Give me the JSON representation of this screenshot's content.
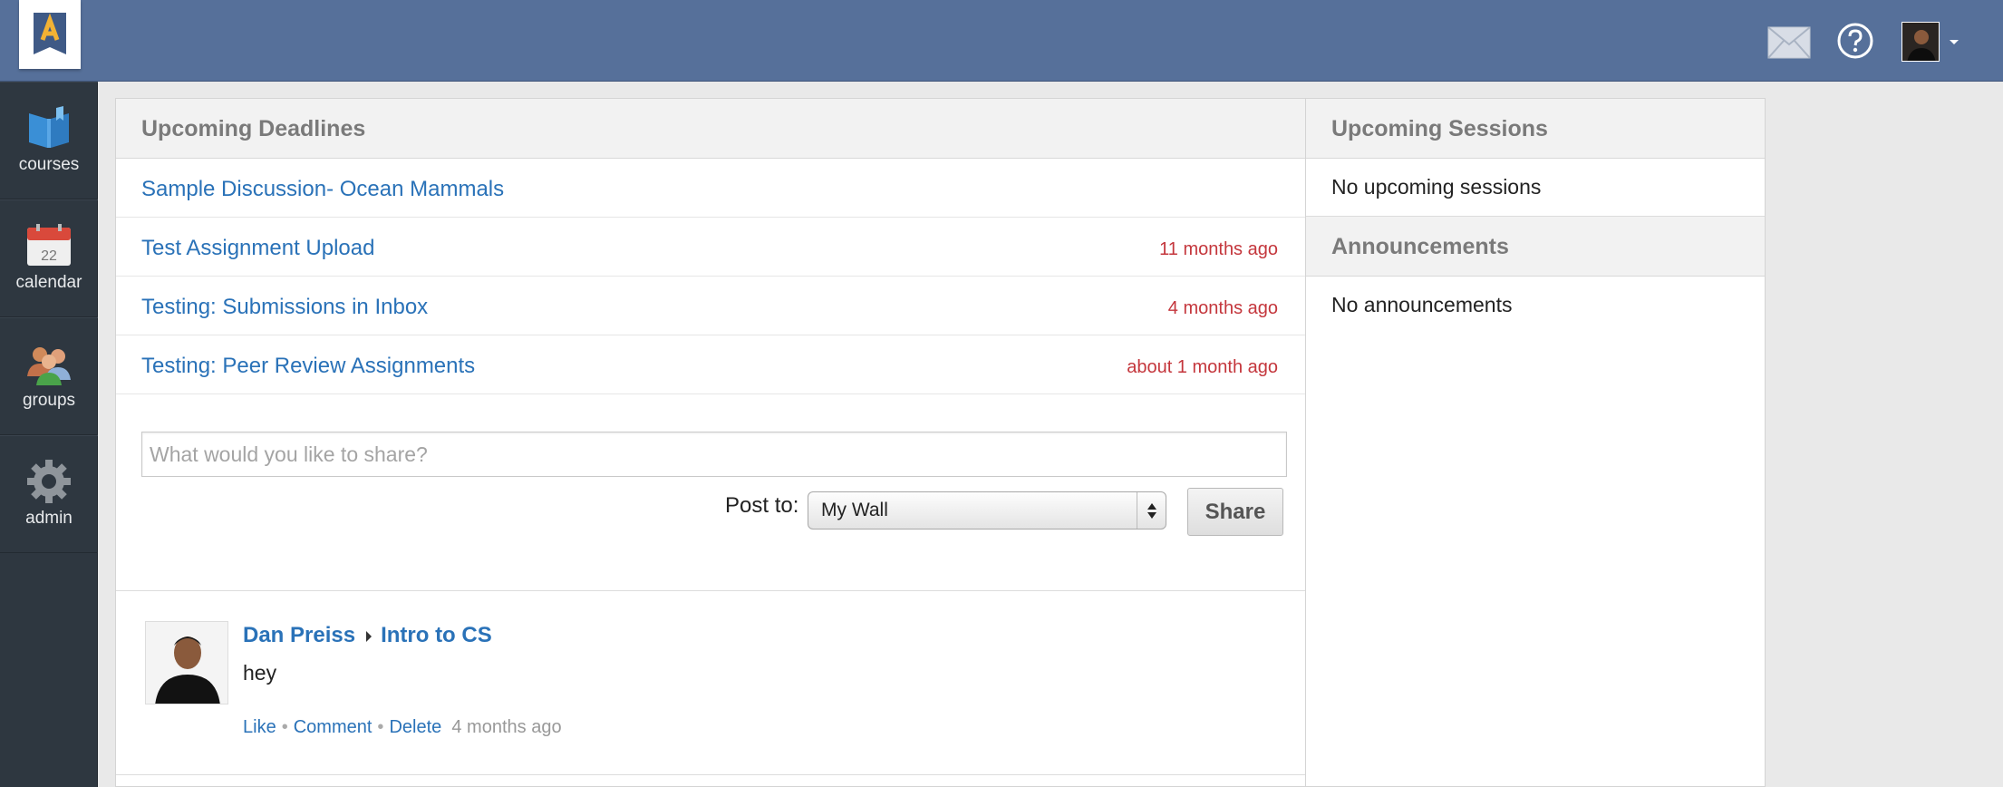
{
  "brand": {
    "logo_letter": "A"
  },
  "topbar": {
    "icons": [
      "mail-icon",
      "help-icon",
      "avatar",
      "chevron-down-icon"
    ]
  },
  "sidebar": {
    "items": [
      {
        "label": "courses",
        "icon": "courses-icon"
      },
      {
        "label": "calendar",
        "icon": "calendar-icon",
        "date": "22"
      },
      {
        "label": "groups",
        "icon": "groups-icon"
      },
      {
        "label": "admin",
        "icon": "gear-icon"
      }
    ]
  },
  "deadlines": {
    "title": "Upcoming Deadlines",
    "items": [
      {
        "title": "Sample Discussion- Ocean Mammals",
        "time": ""
      },
      {
        "title": "Test Assignment Upload",
        "time": "11 months ago"
      },
      {
        "title": "Testing: Submissions in Inbox",
        "time": "4 months ago"
      },
      {
        "title": "Testing: Peer Review Assignments",
        "time": "about 1 month ago"
      }
    ]
  },
  "share": {
    "placeholder": "What would you like to share?",
    "post_to_label": "Post to:",
    "selected": "My Wall",
    "button": "Share"
  },
  "post": {
    "author": "Dan Preiss",
    "target": "Intro to CS",
    "body": "hey",
    "like": "Like",
    "comment": "Comment",
    "delete": "Delete",
    "separator": "•",
    "time": "4 months ago"
  },
  "sessions": {
    "title": "Upcoming Sessions",
    "empty": "No upcoming sessions"
  },
  "announcements": {
    "title": "Announcements",
    "empty": "No announcements"
  },
  "colors": {
    "topbar": "#56709a",
    "sidebar": "#2e3740",
    "link": "#2a72b8",
    "overdue": "#c4363c"
  }
}
